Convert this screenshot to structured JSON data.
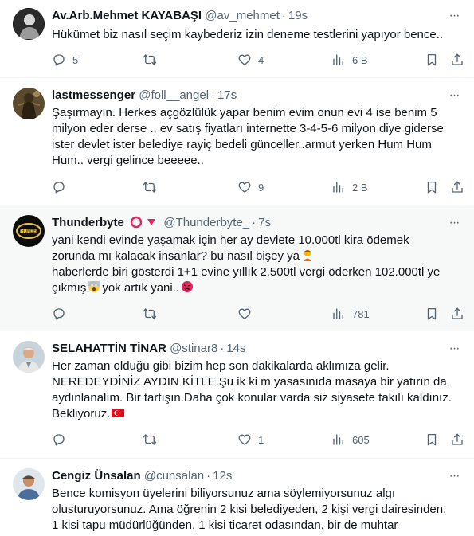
{
  "tweets": [
    {
      "name": "Av.Arb.Mehmet KAYABAŞI",
      "handle": "@av_mehmet",
      "time": "19s",
      "lines": [
        "Hükümet biz nasıl seçim kaybederiz izin deneme testlerini yapıyor bence.."
      ],
      "replies": "5",
      "retweets": "",
      "likes": "4",
      "views": "6 B"
    },
    {
      "name": "lastmessenger",
      "handle": "@foll__angel",
      "time": "17s",
      "lines": [
        "Şaşırmayın. Herkes açgözlülük yapar benim evim onun evi 4 ise benim 5",
        "milyon eder derse .. ev satış fiyatları internette 3-4-5-6 milyon diye giderse",
        "ister devlet ister belediye rayiç bedeli günceller..armut yerken Hum Hum",
        "Hum.. vergi gelince beeeee.."
      ],
      "replies": "",
      "retweets": "",
      "likes": "9",
      "views": "2 B"
    },
    {
      "name": "Thunderbyte",
      "handle": "@Thunderbyte_",
      "time": "7s",
      "lines": [
        "yani kendi evinde yaşamak için her ay devlete 10.000tl kira ödemek",
        "zorunda mı kalacak insanlar? bu nasıl bişey ya",
        "haberlerde biri gösterdi 1+1 evine yıllık 2.500tl vergi öderken 102.000tl ye",
        "çıkmış",
        "yok artık yani.."
      ],
      "replies": "",
      "retweets": "",
      "likes": "",
      "views": "781"
    },
    {
      "name": "SELAHATTİN TİNAR",
      "handle": "@stinar8",
      "time": "14s",
      "lines": [
        "Her zaman olduğu gibi bizim hep son dakikalarda aklımıza gelir.",
        "NEREDEYDİNİZ AYDIN KİTLE.Şu ik ki m yasasınıda masaya bir yatırın da",
        "aydınlanalım. Bir tartışın.Daha çok konular varda siz siyasete takılı kaldınız.",
        "Bekliyoruz."
      ],
      "replies": "",
      "retweets": "",
      "likes": "1",
      "views": "605"
    },
    {
      "name": "Cengiz Ünsalan",
      "handle": "@cunsalan",
      "time": "12s",
      "lines": [
        "Bence komisyon üyelerini biliyorsunuz ama söylemiyorsunuz algı",
        "olusturuyorsunuz. Ama öğrenin 2 kisi belediyeden, 2 kişi vergi dairesinden,",
        "1 kisi tapu müdürlüğünden, 1 kisi ticaret odasından, bir de muhtar"
      ]
    }
  ],
  "colors": {
    "text": "#0f1419",
    "muted": "#536471",
    "divider": "#eff3f4",
    "highlight_bg": "#f7f9f9"
  },
  "icons": [
    "reply-icon",
    "retweet-icon",
    "like-icon",
    "views-icon",
    "bookmark-icon",
    "share-icon",
    "more-icon",
    "flag-tr-icon"
  ]
}
